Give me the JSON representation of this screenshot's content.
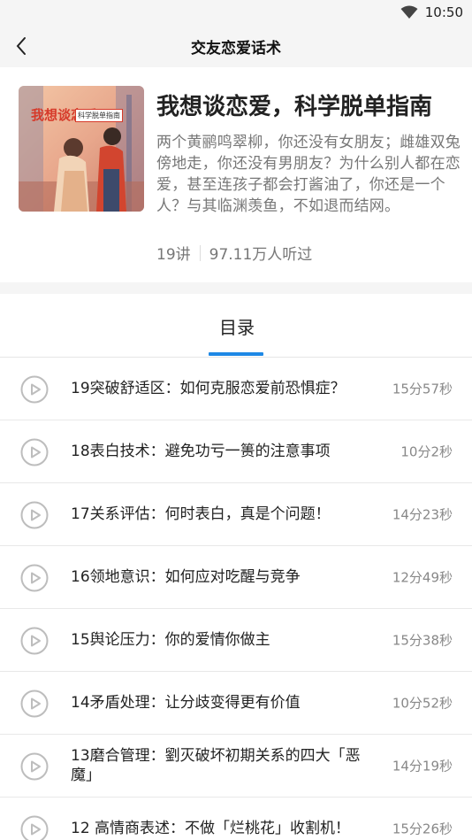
{
  "status_bar": {
    "time": "10:50"
  },
  "nav": {
    "title": "交友恋爱话术"
  },
  "course": {
    "cover_title": "我想谈恋爱",
    "cover_subtitle": "科学脱单指南",
    "title": "我想谈恋爱，科学脱单指南",
    "description": "两个黄鹂鸣翠柳，你还没有女朋友；雌雄双兔傍地走，你还没有男朋友？为什么别人都在恋爱，甚至连孩子都会打酱油了，你还是一个人？与其临渊羡鱼，不如退而结网。",
    "lectures": "19讲",
    "listeners": "97.11万人听过"
  },
  "tabs": {
    "catalog": "目录"
  },
  "colors": {
    "accent": "#1e88e5",
    "muted": "#777777"
  },
  "lessons": [
    {
      "title": "19突破舒适区：如何克服恋爱前恐惧症？",
      "duration": "15分57秒"
    },
    {
      "title": "18表白技术：避免功亏一篑的注意事项",
      "duration": "10分2秒"
    },
    {
      "title": "17关系评估：何时表白，真是个问题！",
      "duration": "14分23秒"
    },
    {
      "title": "16领地意识：如何应对吃醒与竞争",
      "duration": "12分49秒"
    },
    {
      "title": "15舆论压力：你的爱情你做主",
      "duration": "15分38秒"
    },
    {
      "title": "14矛盾处理：让分歧变得更有价值",
      "duration": "10分52秒"
    },
    {
      "title": "13磨合管理：劉灭破坏初期关系的四大「恶魔」",
      "duration": "14分19秒"
    },
    {
      "title": "12 高情商表述：不做「烂桃花」收割机！",
      "duration": "15分26秒"
    }
  ]
}
